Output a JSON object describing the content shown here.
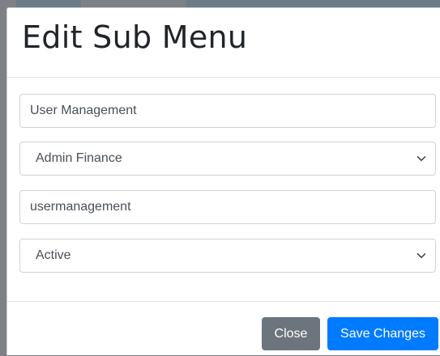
{
  "modal": {
    "title": "Edit Sub Menu",
    "fields": {
      "submenu_title": {
        "value": "User Management"
      },
      "menu_select": {
        "selected": "Admin Finance"
      },
      "url": {
        "value": "usermanagement"
      },
      "status_select": {
        "selected": "Active"
      }
    },
    "footer": {
      "close_label": "Close",
      "save_label": "Save Changes"
    }
  },
  "colors": {
    "primary": "#007bff",
    "secondary": "#6c757d",
    "backdrop": "#7d8185"
  },
  "icons": {
    "select_arrow": "chevron-down-icon"
  }
}
